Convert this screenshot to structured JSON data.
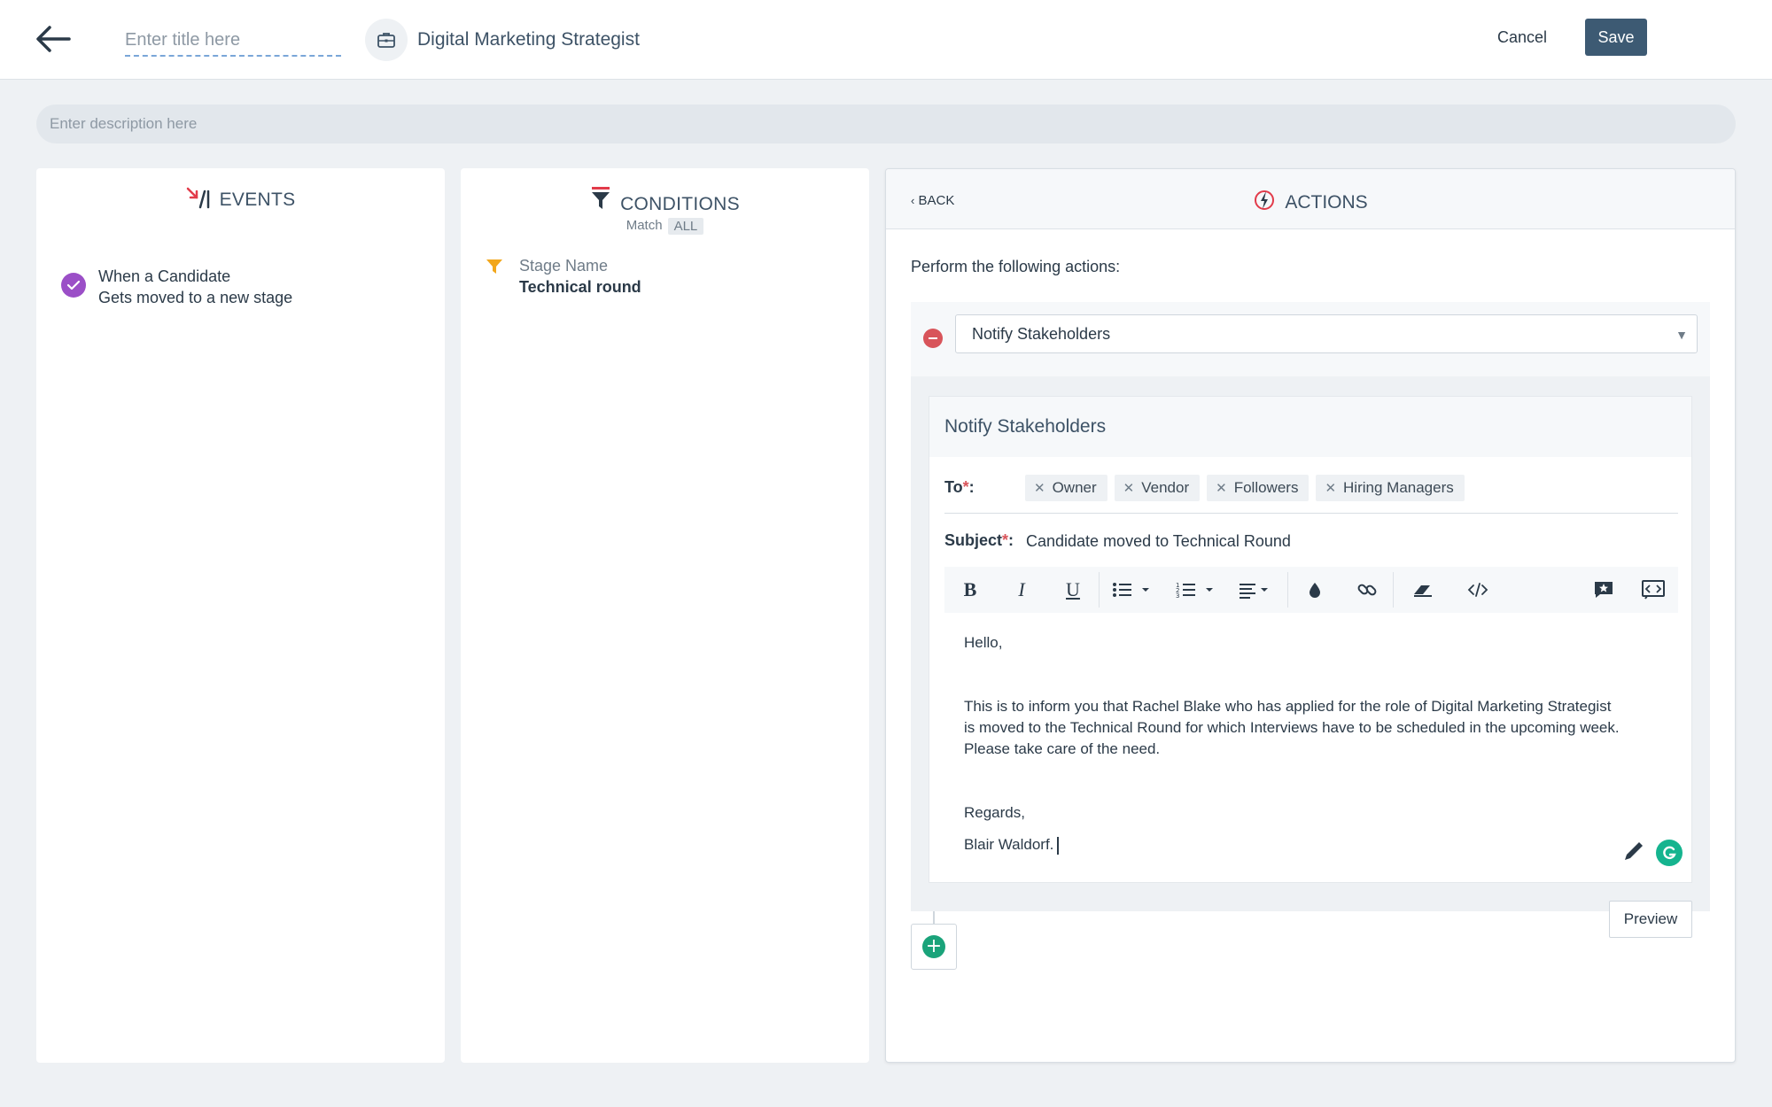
{
  "header": {
    "title_placeholder": "Enter title here",
    "job_title": "Digital Marketing Strategist",
    "cancel_label": "Cancel",
    "save_label": "Save",
    "description_placeholder": "Enter description here"
  },
  "events": {
    "heading": "EVENTS",
    "items": [
      {
        "line1": "When a Candidate",
        "line2": "Gets moved to a new stage"
      }
    ]
  },
  "conditions": {
    "heading": "CONDITIONS",
    "match_label": "Match",
    "match_value": "ALL",
    "items": [
      {
        "label": "Stage Name",
        "value": "Technical round"
      }
    ]
  },
  "actions": {
    "back_label": "BACK",
    "heading": "ACTIONS",
    "intro": "Perform the following actions:",
    "selected_action": "Notify Stakeholders",
    "card": {
      "title": "Notify Stakeholders",
      "to_label": "To",
      "subject_label": "Subject",
      "required_mark": "*",
      "recipients": [
        "Owner",
        "Vendor",
        "Followers",
        "Hiring Managers"
      ],
      "subject_value": "Candidate moved to Technical Round",
      "body": {
        "greeting": "Hello,",
        "line1": "This is to inform you that Rachel Blake who has applied for the role of Digital Marketing Strategist",
        "line2": "is moved to the Technical Round for which Interviews have to be scheduled in the upcoming week.",
        "line3": "Please take care of the need.",
        "closing": "Regards,",
        "signature": "Blair Waldorf."
      }
    },
    "preview_label": "Preview"
  },
  "colors": {
    "save_button": "#3d5a73",
    "event_check": "#9b4fc7",
    "condition_filter": "#f2a71c",
    "remove_action": "#d8545a",
    "add_action": "#1aa37a",
    "grammar_badge": "#15b48f"
  }
}
